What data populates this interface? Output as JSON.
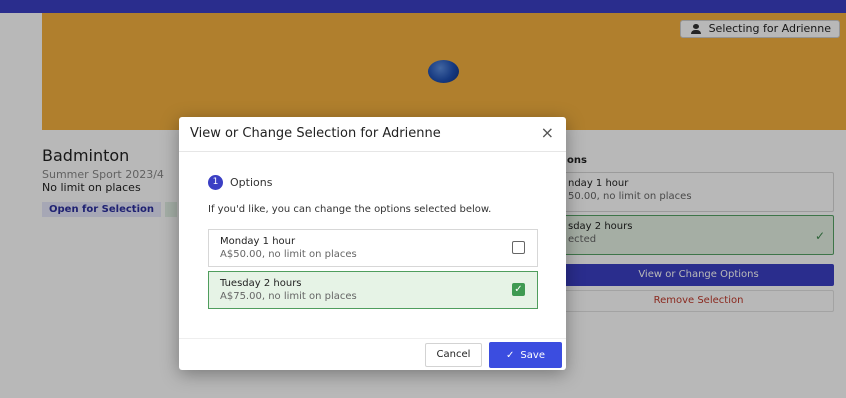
{
  "header": {
    "selecting_label": "Selecting for Adrienne",
    "user_icon": "user-icon"
  },
  "activity": {
    "title": "Badminton",
    "season": "Summer Sport 2023/4",
    "places": "No limit on places",
    "status": "Open for Selection"
  },
  "options_panel": {
    "title": "ons",
    "items": [
      {
        "name": "nday 1 hour",
        "detail": "50.00, no limit on places",
        "selected": false
      },
      {
        "name": "sday 2 hours",
        "detail": "ected",
        "selected": true
      }
    ],
    "view_change_label": "View or Change Options",
    "remove_label": "Remove Selection"
  },
  "modal": {
    "title": "View or Change Selection for Adrienne",
    "close_glyph": "×",
    "step_number": "1",
    "step_label": "Options",
    "intro": "If you'd like, you can change the options selected below.",
    "options": [
      {
        "name": "Monday 1 hour",
        "detail": "A$50.00, no limit on places",
        "selected": false
      },
      {
        "name": "Tuesday 2 hours",
        "detail": "A$75.00, no limit on places",
        "selected": true
      }
    ],
    "cancel_label": "Cancel",
    "save_label": "Save"
  },
  "colors": {
    "accent": "#3b3fc4",
    "banner": "#f4b13f",
    "selected_bg": "#e6f3e6",
    "check_green": "#3f9a52"
  }
}
